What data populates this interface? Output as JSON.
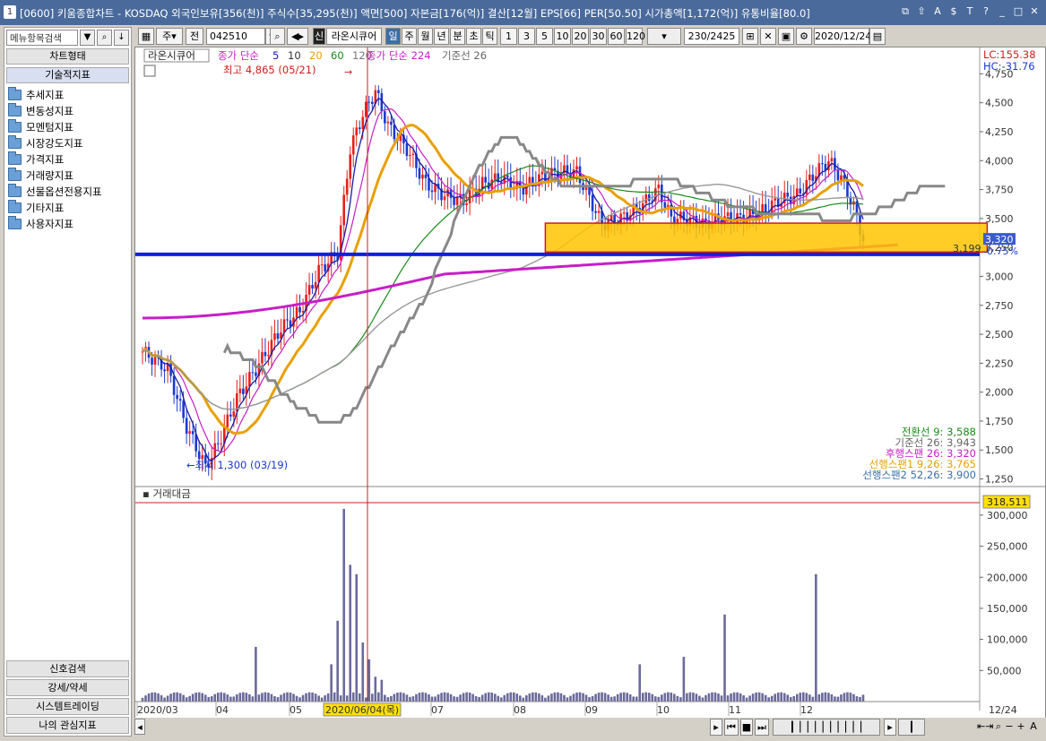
{
  "window": {
    "number": "1",
    "title": "[0600] 키움종합차트 - KOSDAQ 외국인보유[356(천)] 주식수[35,295(천)] 액면[500] 자본금[176(억)] 결산[12월] EPS[66] PER[50.50] 시가총액[1,172(억)] 유통비율[80.0]"
  },
  "left": {
    "search_placeholder": "메뉴항목검색",
    "tab_chart_type": "차트형태",
    "tab_tech": "기술적지표",
    "tree": [
      "추세지표",
      "변동성지표",
      "모멘텀지표",
      "시장강도지표",
      "가격지표",
      "거래량지표",
      "선물옵션전용지표",
      "기타지표",
      "사용자지표"
    ],
    "bottom_tabs": [
      "신호검색",
      "강세/약세",
      "시스템트레이딩",
      "나의 관심지표"
    ]
  },
  "toolbar": {
    "period_main": "주",
    "prev": "전",
    "code": "042510",
    "new_badge": "신",
    "stock_name": "라온시큐어",
    "periods": [
      "일",
      "주",
      "월",
      "년",
      "분",
      "초",
      "틱"
    ],
    "ranges": [
      "1",
      "3",
      "5",
      "10",
      "20",
      "30",
      "60",
      "120"
    ],
    "count": "230",
    "total": "/2425",
    "date": "2020/12/24"
  },
  "price_chart": {
    "stock_label": "라온시큐어",
    "ma_label": "종가 단순",
    "ma": [
      {
        "label": "5",
        "color": "#1a1aa8"
      },
      {
        "label": "10",
        "color": "#333"
      },
      {
        "label": "20",
        "color": "#e8a000"
      },
      {
        "label": "60",
        "color": "#1a8a1a"
      },
      {
        "label": "120",
        "color": "#777"
      }
    ],
    "ma2_label": "종가 단순 224",
    "kijun_label": "기준선 26",
    "high_note": "최고 4,865 (05/21)",
    "low_note": "최저 1,300 (03/19)",
    "lc": "LC:155.38",
    "hc": "HC:-31.76",
    "current_price": "3,320",
    "current_pct": "-0.75%",
    "box_label": "3,199",
    "y_ticks": [
      "4,750",
      "4,500",
      "4,250",
      "4,000",
      "3,750",
      "3,500",
      "3,250",
      "3,000",
      "2,750",
      "2,500",
      "2,250",
      "2,000",
      "1,750",
      "1,500",
      "1,250"
    ],
    "ichimoku": [
      {
        "text": "전환선 9: 3,588",
        "color": "#1a8a1a"
      },
      {
        "text": "기준선 26: 3,943",
        "color": "#666"
      },
      {
        "text": "후행스팬 26: 3,320",
        "color": "#c81ec8"
      },
      {
        "text": "선행스팬1 9,26: 3,765",
        "color": "#e8a000"
      },
      {
        "text": "선행스팬2 52,26: 3,900",
        "color": "#3a6ea8"
      }
    ],
    "colors": {
      "up": "#e8201c",
      "down": "#1a3ad0",
      "ma224": "#c81ec8",
      "hline": "#1020e0",
      "box": "#ffc400"
    }
  },
  "volume_chart": {
    "label": "거래대금",
    "current": "318,511",
    "y_ticks": [
      "300,000",
      "250,000",
      "200,000",
      "150,000",
      "100,000",
      "50,000"
    ]
  },
  "x_axis": {
    "labels": [
      "2020/03",
      "04",
      "05",
      "2020/06/04(목)",
      "07",
      "08",
      "09",
      "10",
      "11",
      "12"
    ],
    "right_label": "12/24"
  }
}
